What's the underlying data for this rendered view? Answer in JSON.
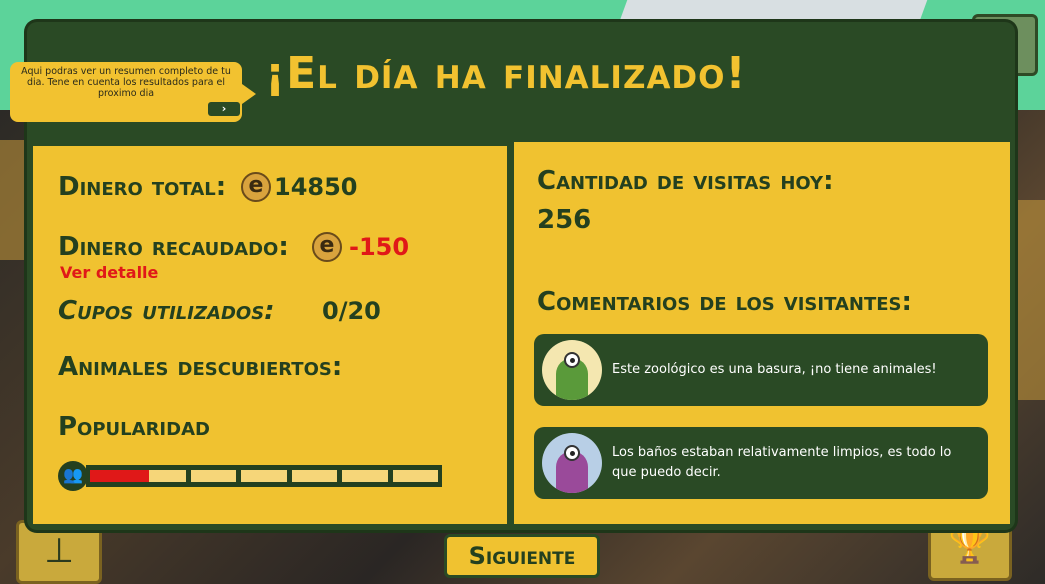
{
  "header": {
    "title": "¡El día ha finalizado!"
  },
  "tooltip": {
    "text": "Aqui podras ver un resumen completo de tu dia. Tene en cuenta los resultados para el proximo dia",
    "next_icon": "›"
  },
  "stats": {
    "dinero_total_label": "Dinero total:",
    "dinero_total_value": "14850",
    "dinero_recaudado_label": "Dinero recaudado:",
    "dinero_recaudado_value": "-150",
    "ver_detalle": "Ver detalle",
    "cupos_label": "Cupos utilizados:",
    "cupos_value": "0/20",
    "animales_label": "Animales descubiertos:",
    "popularidad_label": "Popularidad",
    "popularidad_fraction": 0.17,
    "popularidad_segments": 7
  },
  "visits": {
    "label": "Cantidad de visitas hoy:",
    "value": "256"
  },
  "comments": {
    "label": "Comentarios de los visitantes:",
    "items": [
      {
        "text": "Este zoológico es una basura, ¡no tiene animales!",
        "avatar": "green-visitor-avatar"
      },
      {
        "text": "Los baños estaban relativamente limpios, es todo lo que puedo decir.",
        "avatar": "purple-visitor-avatar"
      }
    ]
  },
  "footer": {
    "siguiente": "Siguiente"
  },
  "colors": {
    "panel": "#2a4a25",
    "accent": "#f0c230",
    "negative": "#e01818"
  },
  "icons": {
    "coin": "coin-icon",
    "popularity": "people-icon",
    "trophy": "trophy-icon"
  }
}
